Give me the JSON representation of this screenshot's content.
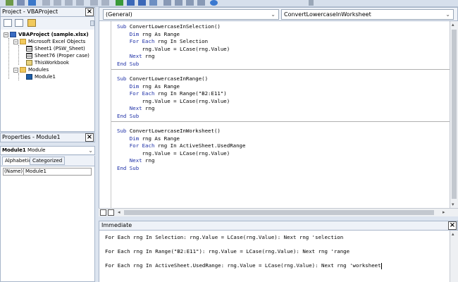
{
  "project_panel": {
    "title": "Project - VBAProject",
    "tree": {
      "project": "VBAProject (sample.xlsx)",
      "excel_objects_folder": "Microsoft Excel Objects",
      "sheets": [
        "Sheet1 (PSW_Sheet)",
        "Sheet76 (Proper case)",
        "ThisWorkbook"
      ],
      "modules_folder": "Modules",
      "modules": [
        "Module1"
      ]
    }
  },
  "properties_panel": {
    "title": "Properties - Module1",
    "object_name": "Module1",
    "object_type": "Module",
    "tabs": [
      "Alphabetic",
      "Categorized"
    ],
    "rows": [
      {
        "name": "(Name)",
        "value": "Module1"
      }
    ]
  },
  "code_window": {
    "object_dropdown": "(General)",
    "procedure_dropdown": "ConvertLowercaseInWorksheet",
    "procedures": [
      {
        "lines": [
          {
            "kw": "Sub ",
            "text": "ConvertLowercaseInSelection()"
          },
          {
            "kw": "    Dim ",
            "text": "rng As Range"
          },
          {
            "kw": "    For Each ",
            "text": "rng In Selection"
          },
          {
            "kw": "",
            "text": "        rng.Value = LCase(rng.Value)"
          },
          {
            "kw": "    Next ",
            "text": "rng"
          },
          {
            "kw": "End Sub",
            "text": ""
          }
        ]
      },
      {
        "lines": [
          {
            "kw": "Sub ",
            "text": "ConvertLowercaseInRange()"
          },
          {
            "kw": "    Dim ",
            "text": "rng As Range"
          },
          {
            "kw": "    For Each ",
            "text": "rng In Range(\"B2:E11\")"
          },
          {
            "kw": "",
            "text": "        rng.Value = LCase(rng.Value)"
          },
          {
            "kw": "    Next ",
            "text": "rng"
          },
          {
            "kw": "End Sub",
            "text": ""
          }
        ]
      },
      {
        "lines": [
          {
            "kw": "Sub ",
            "text": "ConvertLowercaseInWorksheet()"
          },
          {
            "kw": "    Dim ",
            "text": "rng As Range"
          },
          {
            "kw": "    For Each ",
            "text": "rng In ActiveSheet.UsedRange"
          },
          {
            "kw": "",
            "text": "        rng.Value = LCase(rng.Value)"
          },
          {
            "kw": "    Next ",
            "text": "rng"
          },
          {
            "kw": "End Sub",
            "text": ""
          }
        ]
      }
    ]
  },
  "immediate_window": {
    "title": "Immediate",
    "lines": [
      "For Each rng In Selection: rng.Value = LCase(rng.Value): Next rng 'selection",
      "For Each rng In Range(\"B2:E11\"): rng.Value = LCase(rng.Value): Next rng 'range",
      "For Each rng In ActiveSheet.UsedRange: rng.Value = LCase(rng.Value): Next rng 'worksheet"
    ]
  },
  "icons": {
    "close": "close-icon",
    "dropdown": "chevron-down-icon",
    "folder": "folder-icon",
    "sheet": "sheet-icon",
    "module": "module-icon"
  },
  "colors": {
    "keyword": "#1c2ea6",
    "panel_bg": "#eef2f8",
    "chrome_bg": "#dce4ef"
  }
}
